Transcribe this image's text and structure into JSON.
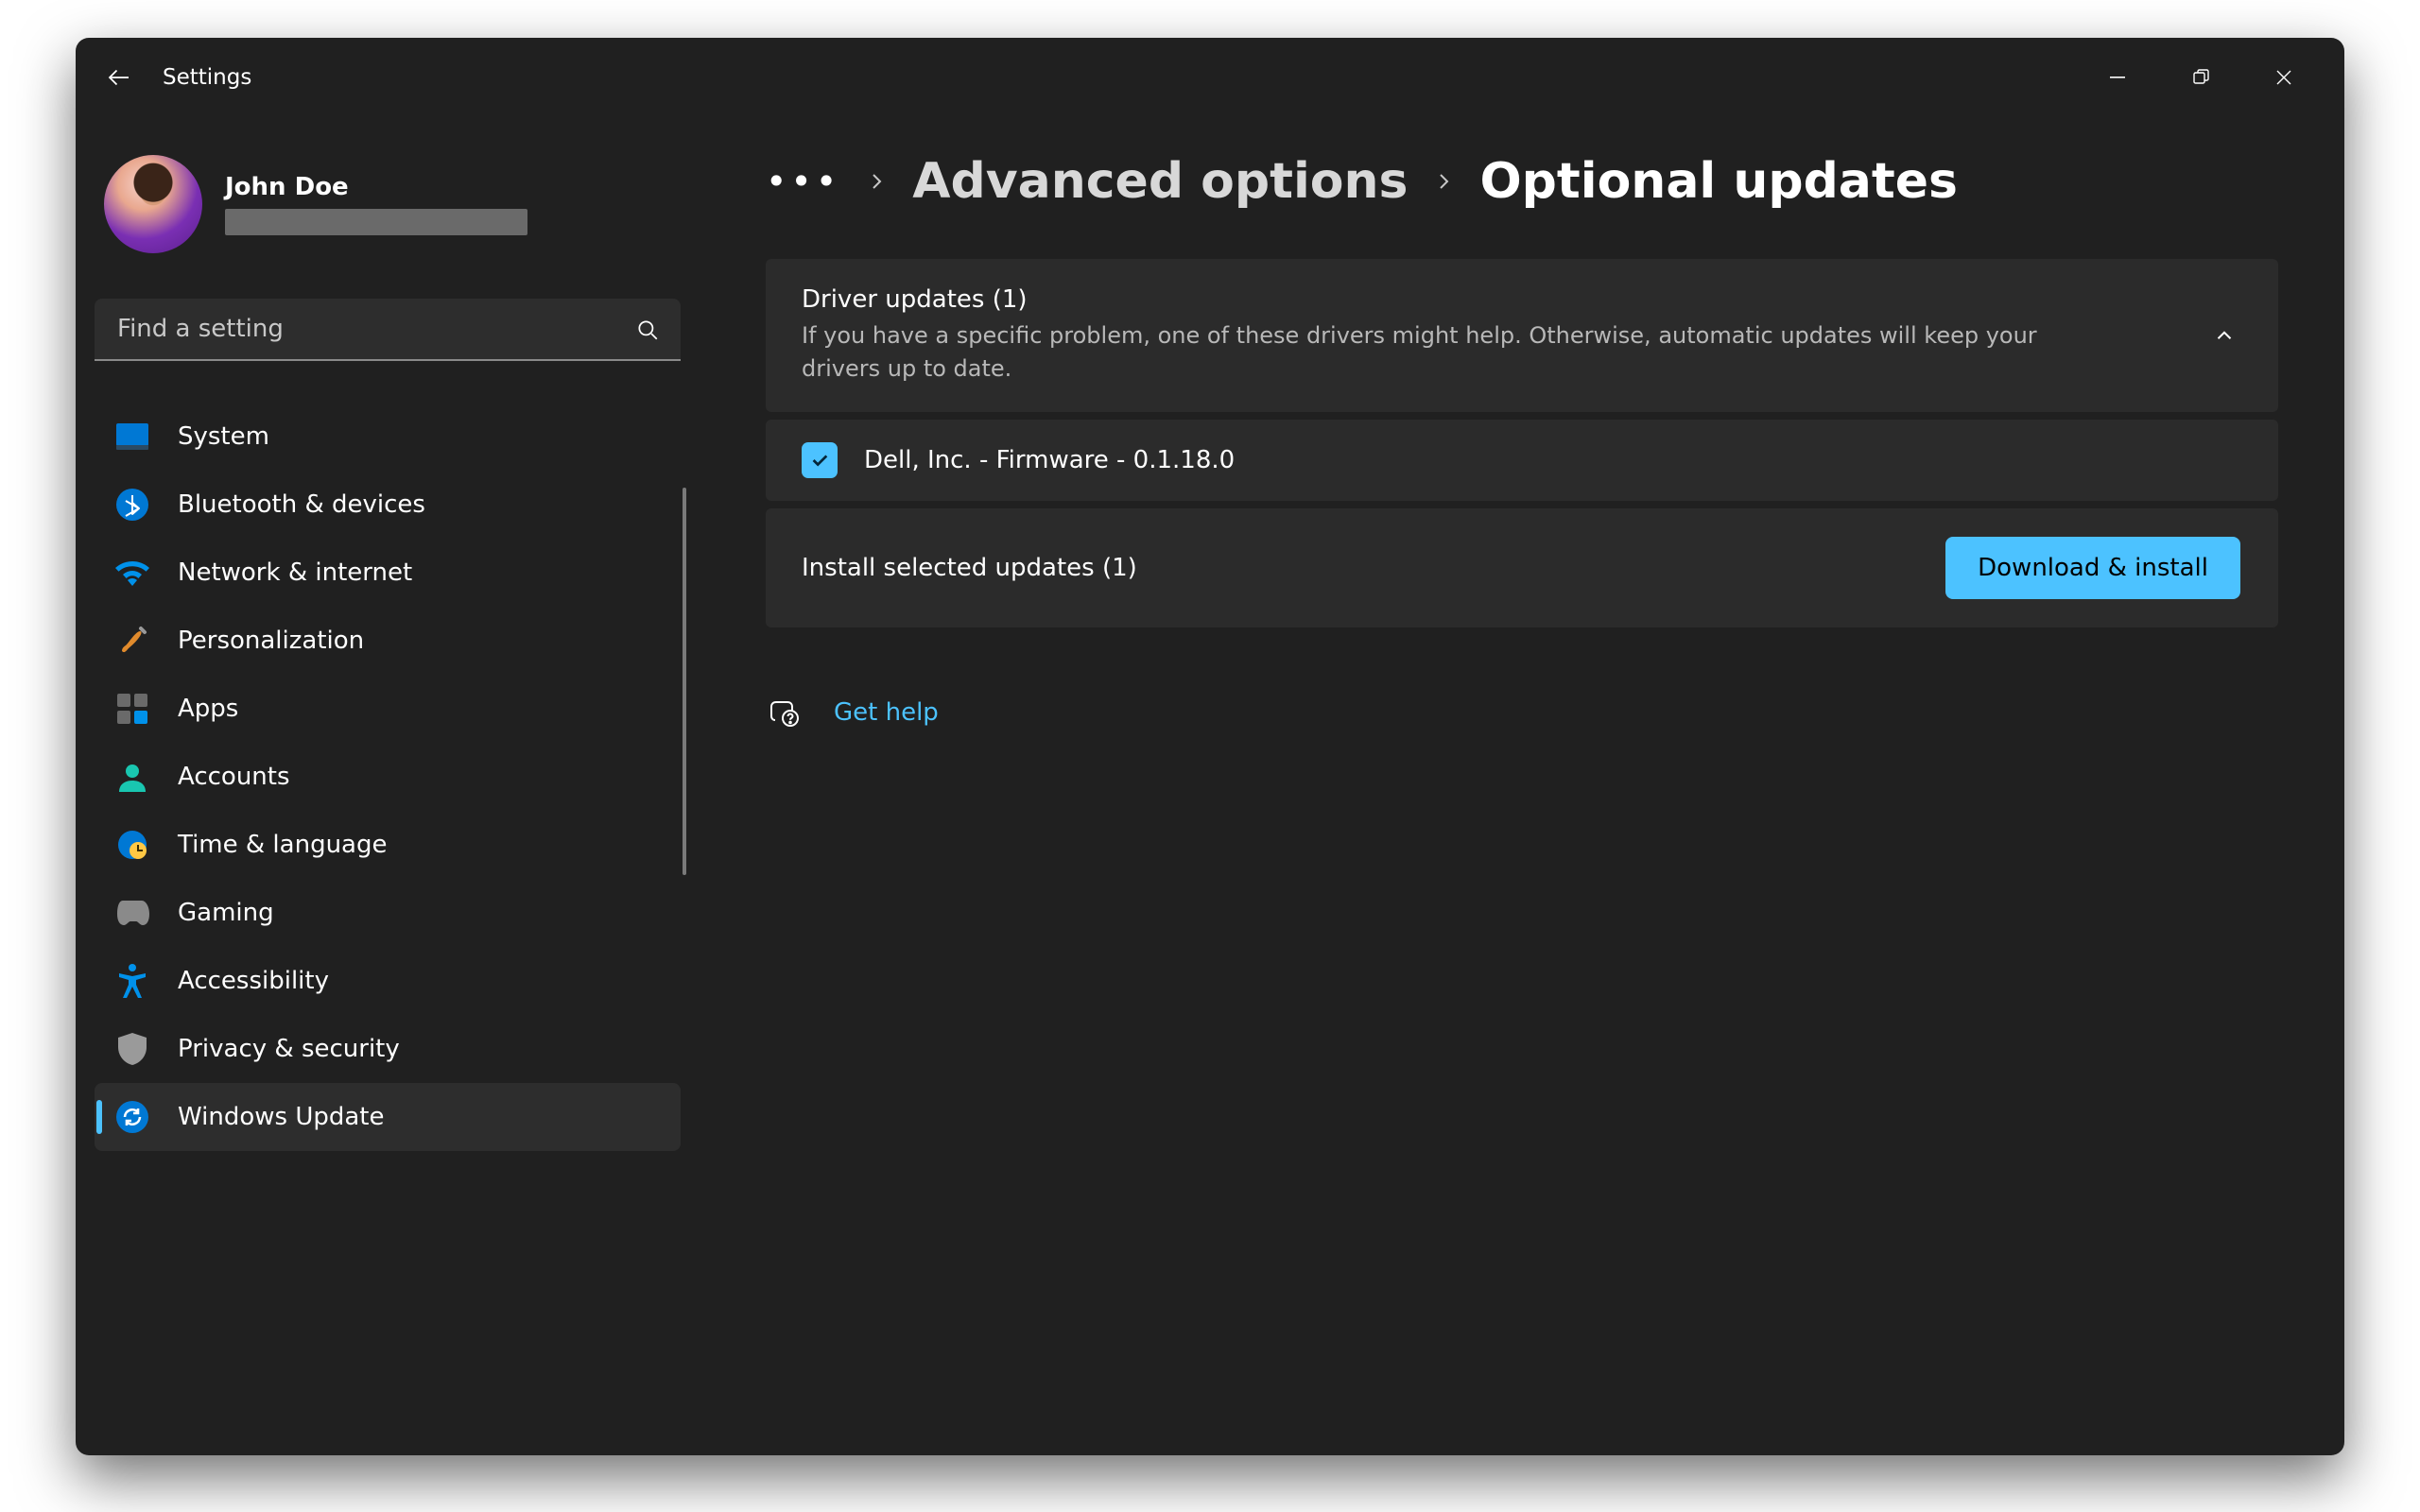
{
  "app_title": "Settings",
  "profile": {
    "name": "John Doe"
  },
  "search": {
    "placeholder": "Find a setting"
  },
  "sidebar": {
    "items": [
      {
        "label": "System"
      },
      {
        "label": "Bluetooth & devices"
      },
      {
        "label": "Network & internet"
      },
      {
        "label": "Personalization"
      },
      {
        "label": "Apps"
      },
      {
        "label": "Accounts"
      },
      {
        "label": "Time & language"
      },
      {
        "label": "Gaming"
      },
      {
        "label": "Accessibility"
      },
      {
        "label": "Privacy & security"
      },
      {
        "label": "Windows Update"
      }
    ]
  },
  "breadcrumb": {
    "prev": "Advanced options",
    "current": "Optional updates"
  },
  "driver_section": {
    "title": "Driver updates (1)",
    "subtitle": "If you have a specific problem, one of these drivers might help. Otherwise, automatic updates will keep your drivers up to date.",
    "items": [
      {
        "label": "Dell, Inc. - Firmware - 0.1.18.0",
        "checked": true
      }
    ]
  },
  "install": {
    "label": "Install selected updates (1)",
    "button": "Download & install"
  },
  "help": {
    "label": "Get help"
  },
  "colors": {
    "accent": "#4cc2ff",
    "bg": "#202020",
    "card": "#2b2b2b"
  }
}
